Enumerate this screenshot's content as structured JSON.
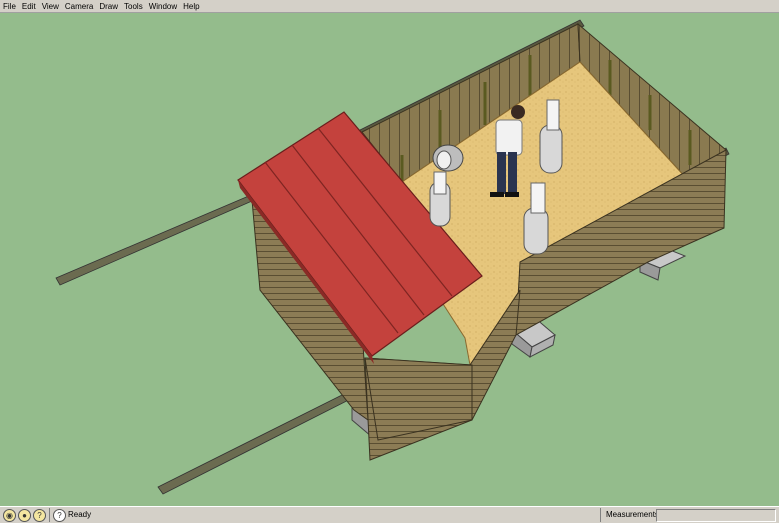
{
  "menu": {
    "items": [
      {
        "label": "File",
        "name": "menu-file"
      },
      {
        "label": "Edit",
        "name": "menu-edit"
      },
      {
        "label": "View",
        "name": "menu-view"
      },
      {
        "label": "Camera",
        "name": "menu-camera"
      },
      {
        "label": "Draw",
        "name": "menu-draw"
      },
      {
        "label": "Tools",
        "name": "menu-tools"
      },
      {
        "label": "Window",
        "name": "menu-window"
      },
      {
        "label": "Help",
        "name": "menu-help"
      }
    ]
  },
  "colors": {
    "ground": "#94bc8c",
    "roof": "#c0403c",
    "wall": "#8a7a52",
    "floor": "#e8c87c"
  },
  "statusbar": {
    "status": "Ready",
    "measurements_label": "Measurements",
    "measurements_value": ""
  },
  "status_icons": [
    "geo-location-icon",
    "credits-icon",
    "help-icon"
  ]
}
